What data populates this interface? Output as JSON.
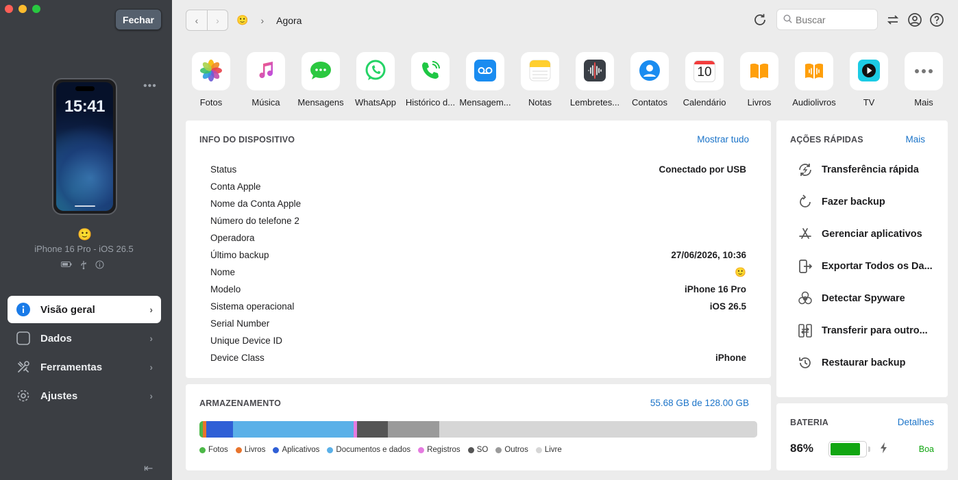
{
  "sidebar": {
    "close_label": "Fechar",
    "phone_time": "15:41",
    "device_emoji": "🙂",
    "device_name": "iPhone 16 Pro - iOS 26.5",
    "nav": [
      {
        "label": "Visão geral",
        "icon": "info-icon"
      },
      {
        "label": "Dados",
        "icon": "square-icon"
      },
      {
        "label": "Ferramentas",
        "icon": "tools-icon"
      },
      {
        "label": "Ajustes",
        "icon": "gear-icon"
      }
    ]
  },
  "topbar": {
    "crumb_emoji": "🙂",
    "crumb_current": "Agora",
    "search_placeholder": "Buscar"
  },
  "apps": [
    {
      "label": "Fotos"
    },
    {
      "label": "Música"
    },
    {
      "label": "Mensagens"
    },
    {
      "label": "WhatsApp"
    },
    {
      "label": "Histórico d..."
    },
    {
      "label": "Mensagem..."
    },
    {
      "label": "Notas"
    },
    {
      "label": "Lembretes..."
    },
    {
      "label": "Contatos"
    },
    {
      "label": "Calendário",
      "day": "10"
    },
    {
      "label": "Livros"
    },
    {
      "label": "Audiolivros"
    },
    {
      "label": "TV"
    },
    {
      "label": "Mais"
    }
  ],
  "info": {
    "title": "INFO DO DISPOSITIVO",
    "show_all": "Mostrar tudo",
    "rows": [
      {
        "k": "Status",
        "v": "Conectado por USB"
      },
      {
        "k": "Conta Apple",
        "v": ""
      },
      {
        "k": "Nome da Conta Apple",
        "v": ""
      },
      {
        "k": "Número do telefone 2",
        "v": ""
      },
      {
        "k": "Operadora",
        "v": ""
      },
      {
        "k": "Último backup",
        "v": "27/06/2026, 10:36"
      },
      {
        "k": "Nome",
        "v": "🙂"
      },
      {
        "k": "Modelo",
        "v": "iPhone 16 Pro"
      },
      {
        "k": "Sistema operacional",
        "v": "iOS 26.5"
      },
      {
        "k": "Serial Number",
        "v": ""
      },
      {
        "k": "Unique Device ID",
        "v": ""
      },
      {
        "k": "Device Class",
        "v": "iPhone"
      }
    ]
  },
  "storage": {
    "title": "ARMAZENAMENTO",
    "summary": "55.68 GB de 128.00 GB",
    "segments": [
      {
        "name": "Fotos",
        "color": "#4cb847",
        "pct": 0.6
      },
      {
        "name": "Livros",
        "color": "#e8742c",
        "pct": 0.6
      },
      {
        "name": "Aplicativos",
        "color": "#2f5fd6",
        "pct": 4.8
      },
      {
        "name": "Documentos e dados",
        "color": "#5ab0e8",
        "pct": 21.6
      },
      {
        "name": "Registros",
        "color": "#e57be0",
        "pct": 0.6
      },
      {
        "name": "SO",
        "color": "#555555",
        "pct": 5.6
      },
      {
        "name": "Outros",
        "color": "#9a9a9a",
        "pct": 9.2
      },
      {
        "name": "Livre",
        "color": "#d6d6d6",
        "pct": 57.0
      }
    ]
  },
  "quick": {
    "title": "AÇÕES RÁPIDAS",
    "more": "Mais",
    "actions": [
      {
        "label": "Transferência rápida"
      },
      {
        "label": "Fazer backup"
      },
      {
        "label": "Gerenciar aplicativos"
      },
      {
        "label": "Exportar Todos os Da..."
      },
      {
        "label": "Detectar Spyware"
      },
      {
        "label": "Transferir para outro..."
      },
      {
        "label": "Restaurar backup"
      }
    ]
  },
  "battery": {
    "title": "BATERIA",
    "details": "Detalhes",
    "percent_label": "86%",
    "level": 0.86,
    "health": "Boa"
  }
}
